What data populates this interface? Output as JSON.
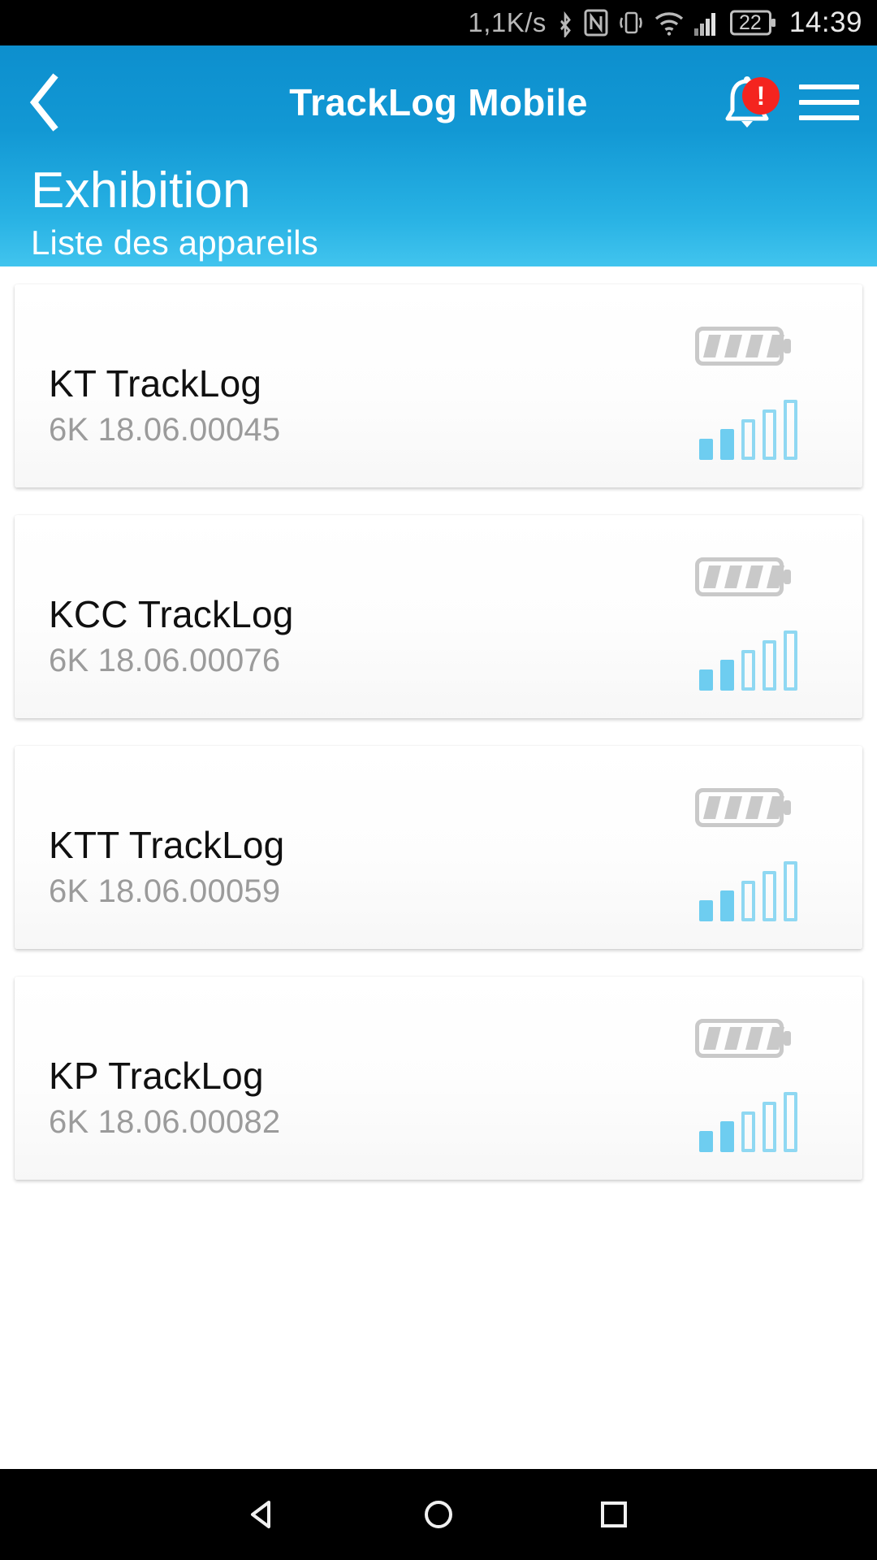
{
  "statusbar": {
    "network_speed": "1,1K/s",
    "icons": [
      "bluetooth-icon",
      "nfc-icon",
      "vibrate-icon",
      "wifi-icon",
      "cellular-signal-icon"
    ],
    "battery_level": "22",
    "time": "14:39"
  },
  "header": {
    "back_label": "back-chevron",
    "app_title": "TrackLog Mobile",
    "notification_badge": "!",
    "page_title": "Exhibition",
    "page_subtitle": "Liste des appareils",
    "accent_color": "#1298d4",
    "accent_color_light": "#41c4ee",
    "badge_color": "#f4241f"
  },
  "devices": [
    {
      "name": "KT TrackLog",
      "serial": "6K 18.06.00045",
      "battery_segments": 4,
      "signal_filled": 2,
      "signal_total": 5
    },
    {
      "name": "KCC TrackLog",
      "serial": "6K 18.06.00076",
      "battery_segments": 4,
      "signal_filled": 2,
      "signal_total": 5
    },
    {
      "name": "KTT TrackLog",
      "serial": "6K 18.06.00059",
      "battery_segments": 4,
      "signal_filled": 2,
      "signal_total": 5
    },
    {
      "name": "KP TrackLog",
      "serial": "6K 18.06.00082",
      "battery_segments": 4,
      "signal_filled": 2,
      "signal_total": 5
    }
  ],
  "navbar": {
    "back_label": "android-back-icon",
    "home_label": "android-home-icon",
    "recents_label": "android-recents-icon"
  },
  "colors": {
    "signal_filled": "#6ecdf0",
    "signal_empty_border": "#8fd8f2",
    "battery_gray": "#c9c9c9",
    "serial_gray": "#9b9b9b"
  }
}
